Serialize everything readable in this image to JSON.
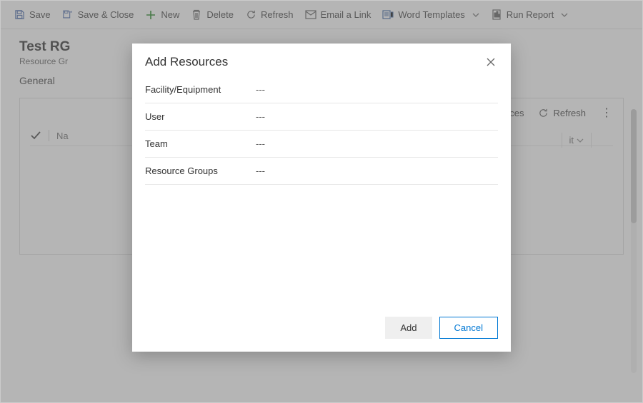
{
  "toolbar": {
    "save": "Save",
    "saveClose": "Save & Close",
    "new": "New",
    "delete": "Delete",
    "refresh": "Refresh",
    "emailLink": "Email a Link",
    "wordTemplates": "Word Templates",
    "runReport": "Run Report"
  },
  "page": {
    "title": "Test RG",
    "subtype": "Resource Gr"
  },
  "tabs": {
    "general": "General"
  },
  "grid": {
    "addResources": "Add Resources",
    "refresh": "Refresh",
    "nameColShort": "Na",
    "buSelect": "it"
  },
  "dialog": {
    "title": "Add Resources",
    "fields": [
      {
        "label": "Facility/Equipment",
        "value": "---"
      },
      {
        "label": "User",
        "value": "---"
      },
      {
        "label": "Team",
        "value": "---"
      },
      {
        "label": "Resource Groups",
        "value": "---"
      }
    ],
    "addBtn": "Add",
    "cancelBtn": "Cancel"
  }
}
